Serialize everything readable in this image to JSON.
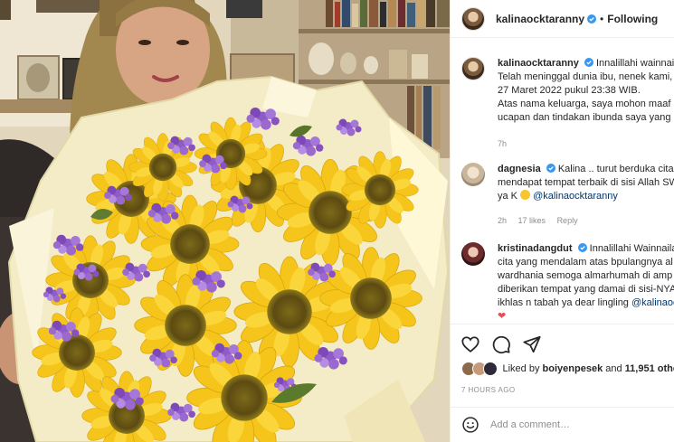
{
  "post": {
    "author": "kalinaocktaranny",
    "follow_status": "Following",
    "photo_alt_subject": "woman holding sunflower bouquet"
  },
  "caption": {
    "username": "kalinaocktaranny",
    "lines": [
      "Innalillahi wainnaila",
      "Telah meninggal dunia ibu, nenek kami,",
      "27 Maret 2022 pukul 23:38 WIB.",
      "Atas nama keluarga, saya mohon maaf s",
      "ucapan dan tindakan ibunda saya yang"
    ],
    "time": "7h"
  },
  "comments": [
    {
      "username": "dagnesia",
      "lines": [
        "Kalina .. turut berduka cita y",
        "mendapat tempat terbaik di sisi Allah SW",
        "ya K"
      ],
      "mention": "@kalinaocktaranny",
      "time": "2h",
      "likes": "17 likes",
      "reply": "Reply"
    },
    {
      "username": "kristinadangdut",
      "lines": [
        "Innalillahi Wainnailaih",
        "cita yang mendalam atas bpulangnya al",
        "wardhania semoga almarhumah di amp",
        "diberikan tempat yang damai di sisi-NYA",
        "ikhlas n tabah ya dear lingling"
      ],
      "mention": "@kalinaoc"
    }
  ],
  "actions": {
    "like": "heart-icon",
    "comment": "comment-icon",
    "share": "share-icon"
  },
  "likes": {
    "prefix": "Liked by",
    "user": "boiyenpesek",
    "and": "and",
    "count": "11,951 othe"
  },
  "time_ago": "7 HOURS AGO",
  "add_comment": {
    "placeholder": "Add a comment…",
    "icon": "emoji-icon"
  },
  "colors": {
    "verified": "#3897f0",
    "link": "#00376b",
    "muted": "#8e8e8e",
    "text": "#262626"
  }
}
